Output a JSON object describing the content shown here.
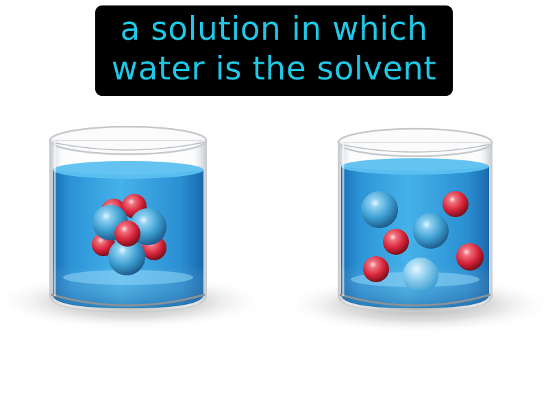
{
  "caption": {
    "line1": "a solution in which",
    "line2": "water is the solvent"
  },
  "colors": {
    "caption_background": "#000000",
    "caption_text": "#1ec8e6",
    "water": "#2a9ad8",
    "solute_blue": "#3d9fd0",
    "solute_red": "#d6243a",
    "glass": "#d8dcdf"
  },
  "beakers": [
    {
      "name": "undissolved-solute-beaker",
      "particle_arrangement": "clustered",
      "blue_particles": 4,
      "red_particles": 4
    },
    {
      "name": "dissolved-solution-beaker",
      "particle_arrangement": "dispersed",
      "blue_particles": 3,
      "red_particles": 4
    }
  ]
}
